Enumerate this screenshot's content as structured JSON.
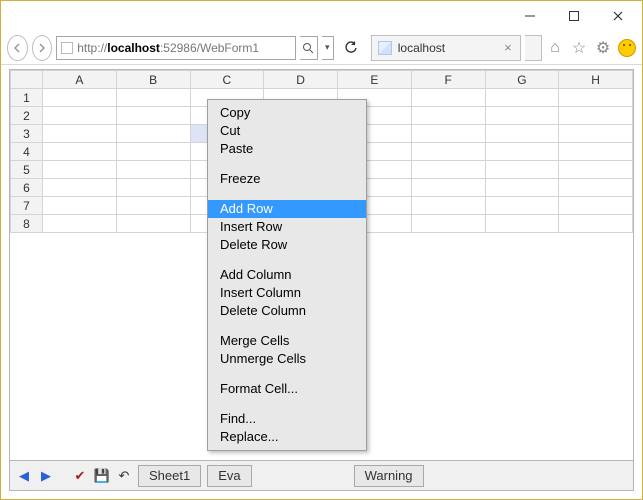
{
  "window": {
    "minimize": "—",
    "maximize": "▢",
    "close": "✕"
  },
  "address": {
    "protocol": "http://",
    "host": "localhost",
    "rest": ":52986/WebForm1",
    "search_glyph": "🔍",
    "dropdown_glyph": "▾",
    "refresh_glyph": "↻"
  },
  "tab": {
    "title": "localhost",
    "close": "×"
  },
  "toolbar_icons": {
    "home": "⌂",
    "star": "☆",
    "gear": "⚙"
  },
  "grid": {
    "columns": [
      "A",
      "B",
      "C",
      "D",
      "E",
      "F",
      "G",
      "H"
    ],
    "rows": [
      "1",
      "2",
      "3",
      "4",
      "5",
      "6",
      "7",
      "8"
    ],
    "selected": {
      "row": 3,
      "col": "C"
    }
  },
  "context_menu": {
    "groups": [
      [
        "Copy",
        "Cut",
        "Paste"
      ],
      [
        "Freeze"
      ],
      [
        "Add Row",
        "Insert Row",
        "Delete Row"
      ],
      [
        "Add Column",
        "Insert Column",
        "Delete Column"
      ],
      [
        "Merge Cells",
        "Unmerge Cells"
      ],
      [
        "Format Cell..."
      ],
      [
        "Find...",
        "Replace..."
      ]
    ],
    "selected": "Add Row"
  },
  "bottom": {
    "nav_prev": "◀",
    "nav_next": "▶",
    "check": "✔",
    "save": "💾",
    "undo": "↶",
    "sheet_tab": "Sheet1",
    "button1": "Eva",
    "button2": "Warning"
  }
}
